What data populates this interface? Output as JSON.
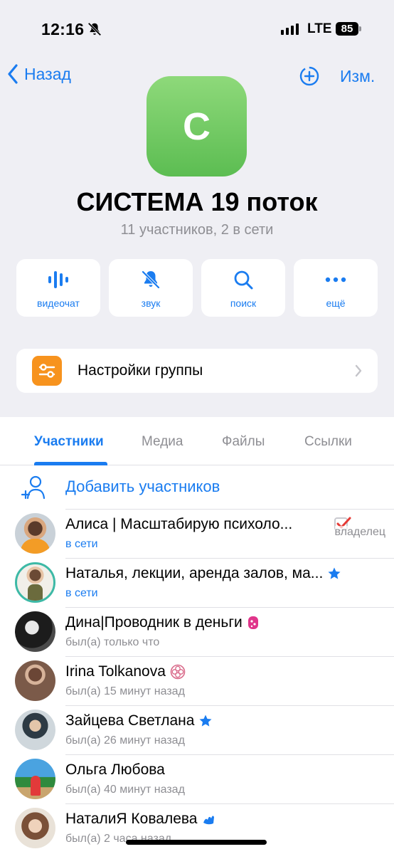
{
  "status_bar": {
    "time": "12:16",
    "network": "LTE",
    "battery": "85"
  },
  "nav": {
    "back_label": "Назад",
    "edit_label": "Изм."
  },
  "group": {
    "avatar_letter": "С",
    "title": "СИСТЕМА 19 поток",
    "subtitle": "11 участников, 2 в сети"
  },
  "actions": [
    {
      "label": "видеочат",
      "icon": "voice-chat-icon"
    },
    {
      "label": "звук",
      "icon": "bell-muted-icon"
    },
    {
      "label": "поиск",
      "icon": "search-icon"
    },
    {
      "label": "ещё",
      "icon": "more-icon"
    }
  ],
  "settings": {
    "label": "Настройки группы",
    "icon": "sliders-icon"
  },
  "tabs": [
    {
      "label": "Участники",
      "active": true
    },
    {
      "label": "Медиа"
    },
    {
      "label": "Файлы"
    },
    {
      "label": "Ссылки"
    }
  ],
  "add_members": {
    "label": "Добавить участников"
  },
  "members": [
    {
      "name": "Алиса | Масштабирую психоло...",
      "status": "в сети",
      "online": true,
      "role": "владелец",
      "badge": "check-icon"
    },
    {
      "name": "Наталья, лекции, аренда залов, ма...",
      "status": "в сети",
      "online": true,
      "badge": "star-icon"
    },
    {
      "name": "Дина|Проводник в деньги",
      "status": "был(а) только что",
      "badge": "pink-emoji-icon"
    },
    {
      "name": "Irina Tolkanova",
      "status": "был(а) 15 минут назад",
      "badge": "flower-icon"
    },
    {
      "name": "Зайцева Светлана",
      "status": "был(а) 26 минут назад",
      "badge": "star-icon"
    },
    {
      "name": "Ольга Любова",
      "status": "был(а) 40 минут назад"
    },
    {
      "name": "НаталиЯ Ковалева",
      "status": "был(а) 2 часа назад",
      "badge": "wave-icon"
    }
  ],
  "colors": {
    "accent": "#1a7cf0",
    "background": "#efeff4",
    "settings_icon": "#f7931e",
    "avatar_green": "#6fca5e"
  }
}
